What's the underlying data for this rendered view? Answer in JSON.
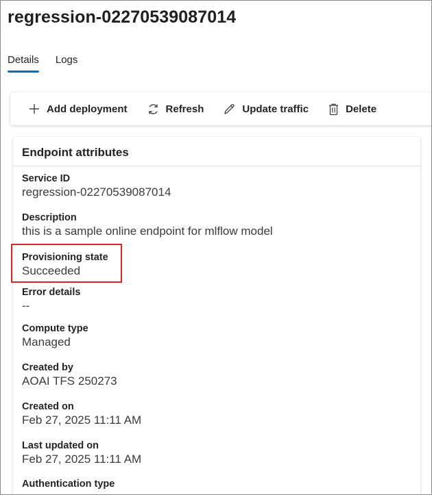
{
  "page": {
    "title": "regression-02270539087014"
  },
  "tabs": [
    {
      "label": "Details",
      "active": true
    },
    {
      "label": "Logs",
      "active": false
    }
  ],
  "toolbar": {
    "add_deployment": {
      "label": "Add deployment",
      "icon": "plus-icon"
    },
    "refresh": {
      "label": "Refresh",
      "icon": "refresh-icon"
    },
    "update_traffic": {
      "label": "Update traffic",
      "icon": "pencil-icon"
    },
    "delete": {
      "label": "Delete",
      "icon": "trash-icon"
    }
  },
  "card": {
    "title": "Endpoint attributes",
    "attributes": [
      {
        "label": "Service ID",
        "value": "regression-02270539087014"
      },
      {
        "label": "Description",
        "value": "this is a sample online endpoint for mlflow model"
      },
      {
        "label": "Provisioning state",
        "value": "Succeeded"
      },
      {
        "label": "Error details",
        "value": "--"
      },
      {
        "label": "Compute type",
        "value": "Managed"
      },
      {
        "label": "Created by",
        "value": "AOAI TFS 250273"
      },
      {
        "label": "Created on",
        "value": "Feb 27, 2025 11:11 AM"
      },
      {
        "label": "Last updated on",
        "value": "Feb 27, 2025 11:11 AM"
      },
      {
        "label": "Authentication type",
        "value": ""
      }
    ]
  },
  "colors": {
    "accent": "#0f6cbd",
    "highlight": "#d8242e"
  }
}
